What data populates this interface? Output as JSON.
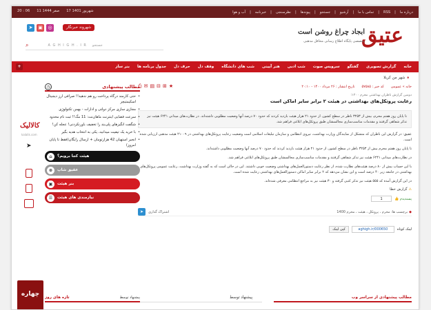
{
  "topbar": {
    "links": [
      "درباره ما",
      "RSS",
      "تماس با ما",
      "آرشیو",
      "جستجو",
      "پیوندها",
      "نظرسنجی",
      "خبرنامه",
      "آب و هوا"
    ],
    "date": [
      "17 شهریور 1401",
      "11 صفر 1444",
      "20 : 06"
    ]
  },
  "header": {
    "logo": "عتیق",
    "title": "ابجاد چراغ روشن است",
    "subtitle": "تخصصی پایگاه اطلاع رسانی محافل مذهبی",
    "news_button": "شهروند خبرنگار",
    "search_placeholder": "A G H I G H . I R",
    "search_label": "جستجو"
  },
  "nav": {
    "items": [
      "خانه",
      "گزارش تصویری",
      "گفتگو",
      "سرویس صوت",
      "شب ادبی",
      "هنر آیینی",
      "شب های دانشگاه",
      "وقف دل",
      "حرف دل",
      "جدول برنامه ها",
      "بنر ساز"
    ],
    "more": "+"
  },
  "breadcrumb": "شهر من کربلا",
  "article": {
    "meta": [
      "خانه » عمومی",
      "کد خبر : ۵۷۵۸۵",
      "تاریخ انتشار : ۲۶ مرداد ۱۴۰۰ - ۲۰:۱۰"
    ],
    "subtitle": "دومین گزارش ناظران بهداشتی محرم ۱۴۰۰؛",
    "headline": "رعایت پروتکل‌های بهداشتی در هیئت ۲ برابر سایر اماکن است",
    "lead": "تا پایان روز هفتم محرم، بیش از ۳۲۵۳ ناظر در سطح کشور، از حدود ۲۱ هزار هیئت بازدید کردند که حدود ۷۰ درصد آنها وضعیت مطلوبی داشته‌اند. در نظارت‌های میدانی ۶۲۴۱ هیئت نیز تذکر شفاهی گرفتند و مقدمات مناسب‌سازی مجالسشان طبق پروتکل‌های ابلاغی فراهم شد.",
    "paragraphs": [
      "عقیق: در گزارش این ناظران که متشکل از نمایندگان وزارت بهداشت، نیروی انتظامی و سازمان تبلیغات اسلامی است وضعیت رعایت پروتکل‌های بهداشتی در ۲۱۰۰۹ هیئت مذهبی ارزیابی شده است.",
      "تا پایان روز هفتم محرم بیش از ۳۲۵۳ ناظر در سطح کشور، از حدود ۲۱ هزار هیئت بازدید کردند که حدود ۷۰ درصد آنها وضعیت مطلوبی داشته‌اند.",
      "در نظارت‌های میدانی ۶۲۴۱ هیئت نیز تذکر شفاهی گرفتند و مقدمات مناسب‌سازی مجالسشان طبق پروتکل‌های ابلاغی فراهم شد.",
      "با این حساب بیش از ۸۰ درصد هیئت‌های نظارت شده، از نظر رعایت دستورالعمل‌های بهداشتی وضعیت خوبی داشتند. این در حالی است که به گفته وزارت بهداشت، رعایت عمومی پروتکل‌های بهداشتی در جامعه زیر ۴۰ درصد است و این نشان می‌دهد که ۲ برابر سایر اماکن دستورالعمل‌های بهداشتی رعایت شده است.",
      "در این گزارش آمده که ۵۵۵ هیئت نیز تذکر کتبی گرفته و ۳۰ هیئت نیز به مراجع انتظامی معرفی شده‌اند."
    ],
    "report": "گزارش خطا",
    "like_label": "پسندیدم",
    "like_count": "1",
    "tags": "برچسب ها: محرم ، پروتکل ، هیئت ، محرم 1400",
    "share": "اشتراک گذاری",
    "short_link_label": "لینک کوتاه",
    "short_link": "aghigh.ir/000650",
    "copy_button": "کپی لینک"
  },
  "bottom": {
    "right_title": "مطالب پیشنهادی از سراسر وب",
    "left_title": "پیشنهاد توسط"
  },
  "sidebar": {
    "title": "مطالب پیشنهادی",
    "items": [
      "حتی کارمند درگاه پرداخت رو هم ندهید!! صرافی ارز دیجیتال اسکیمتیچر",
      "مجازی سازی مرکز دولتی و ادارات - بهمن تکنولوژی",
      "سرعت فضایی اینترنت ماهان‌نت: 11 مگ!! ثبت نام محدود",
      "شگفت انگیزهای پلی‌بند را تخفیف باورنکردنی! عجله کن!",
      "با خرید یک تیفیت میدانید، یکی به انتخاب هدیه بگیر",
      "انجیر استهبان 42 هزارتومان + ارسال رایگان(فقط تا پایان امروز)"
    ],
    "ad_brand": "کالالیک",
    "ad_url": "kalalik.com",
    "buttons": [
      "هیئت کجا برویم؟",
      "عقیق شاپ",
      "بنر هیئت",
      "نیازمندی های هیئت"
    ],
    "recent_title": "تازه های روز",
    "recent_by": "پیشنهاد توسط",
    "ad2": "چهاره"
  },
  "colors": {
    "brand": "#c8161d",
    "topbar": "#6a1e1e",
    "accent": "#c0161c"
  }
}
